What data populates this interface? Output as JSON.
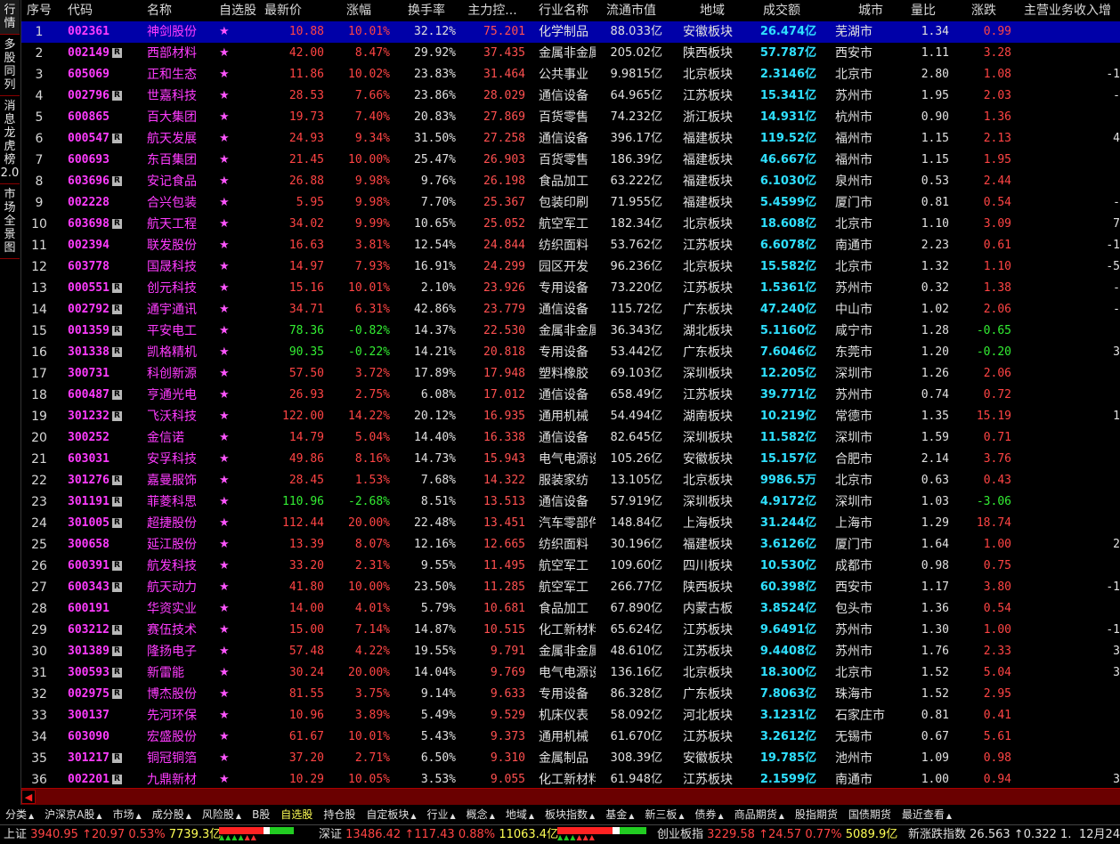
{
  "sidebar": {
    "tabs": [
      "行情",
      "多股同列",
      "消息龙虎榜2.0",
      "市场全景图"
    ]
  },
  "columns": {
    "seq": "序号",
    "code": "代码",
    "name": "名称",
    "fav": "自选股",
    "price": "最新价",
    "pct": "涨幅",
    "turnover": "换手率",
    "main": "主力控...",
    "industry": "行业名称",
    "cap": "流通市值",
    "region": "地域",
    "amount": "成交额",
    "city": "城市",
    "vol_ratio": "量比",
    "change": "涨跌",
    "revenue": "主营业务收入增"
  },
  "rows": [
    {
      "seq": "1",
      "code": "002361",
      "r": false,
      "name": "神剑股份",
      "fav": "★",
      "price": "10.88",
      "pct": "10.01%",
      "turnover": "32.12%",
      "main": "75.201",
      "industry": "化学制品",
      "cap": "88.033亿",
      "region": "安徽板块",
      "amount": "26.474亿",
      "city": "芜湖市",
      "vol_ratio": "1.34",
      "change": "0.99",
      "revenue": "",
      "dir": "up"
    },
    {
      "seq": "2",
      "code": "002149",
      "r": true,
      "name": "西部材料",
      "fav": "★",
      "price": "42.00",
      "pct": "8.47%",
      "turnover": "29.92%",
      "main": "37.435",
      "industry": "金属非金属",
      "cap": "205.02亿",
      "region": "陕西板块",
      "amount": "57.787亿",
      "city": "西安市",
      "vol_ratio": "1.11",
      "change": "3.28",
      "revenue": "",
      "dir": "up"
    },
    {
      "seq": "3",
      "code": "605069",
      "r": false,
      "name": "正和生态",
      "fav": "★",
      "price": "11.86",
      "pct": "10.02%",
      "turnover": "23.83%",
      "main": "31.464",
      "industry": "公共事业",
      "cap": "9.9815亿",
      "region": "北京板块",
      "amount": "2.3146亿",
      "city": "北京市",
      "vol_ratio": "2.80",
      "change": "1.08",
      "revenue": "-1",
      "dir": "up"
    },
    {
      "seq": "4",
      "code": "002796",
      "r": true,
      "name": "世嘉科技",
      "fav": "★",
      "price": "28.53",
      "pct": "7.66%",
      "turnover": "23.86%",
      "main": "28.029",
      "industry": "通信设备",
      "cap": "64.965亿",
      "region": "江苏板块",
      "amount": "15.341亿",
      "city": "苏州市",
      "vol_ratio": "1.95",
      "change": "2.03",
      "revenue": "-",
      "dir": "up"
    },
    {
      "seq": "5",
      "code": "600865",
      "r": false,
      "name": "百大集团",
      "fav": "★",
      "price": "19.73",
      "pct": "7.40%",
      "turnover": "20.83%",
      "main": "27.869",
      "industry": "百货零售",
      "cap": "74.232亿",
      "region": "浙江板块",
      "amount": "14.931亿",
      "city": "杭州市",
      "vol_ratio": "0.90",
      "change": "1.36",
      "revenue": "",
      "dir": "up"
    },
    {
      "seq": "6",
      "code": "000547",
      "r": true,
      "name": "航天发展",
      "fav": "★",
      "price": "24.93",
      "pct": "9.34%",
      "turnover": "31.50%",
      "main": "27.258",
      "industry": "通信设备",
      "cap": "396.17亿",
      "region": "福建板块",
      "amount": "119.52亿",
      "city": "福州市",
      "vol_ratio": "1.15",
      "change": "2.13",
      "revenue": "4",
      "dir": "up"
    },
    {
      "seq": "7",
      "code": "600693",
      "r": false,
      "name": "东百集团",
      "fav": "★",
      "price": "21.45",
      "pct": "10.00%",
      "turnover": "25.47%",
      "main": "26.903",
      "industry": "百货零售",
      "cap": "186.39亿",
      "region": "福建板块",
      "amount": "46.667亿",
      "city": "福州市",
      "vol_ratio": "1.15",
      "change": "1.95",
      "revenue": "",
      "dir": "up"
    },
    {
      "seq": "8",
      "code": "603696",
      "r": true,
      "name": "安记食品",
      "fav": "★",
      "price": "26.88",
      "pct": "9.98%",
      "turnover": "9.76%",
      "main": "26.198",
      "industry": "食品加工",
      "cap": "63.222亿",
      "region": "福建板块",
      "amount": "6.1030亿",
      "city": "泉州市",
      "vol_ratio": "0.53",
      "change": "2.44",
      "revenue": "",
      "dir": "up"
    },
    {
      "seq": "9",
      "code": "002228",
      "r": false,
      "name": "合兴包装",
      "fav": "★",
      "price": "5.95",
      "pct": "9.98%",
      "turnover": "7.70%",
      "main": "25.367",
      "industry": "包装印刷",
      "cap": "71.955亿",
      "region": "福建板块",
      "amount": "5.4599亿",
      "city": "厦门市",
      "vol_ratio": "0.81",
      "change": "0.54",
      "revenue": "-",
      "dir": "up"
    },
    {
      "seq": "10",
      "code": "603698",
      "r": true,
      "name": "航天工程",
      "fav": "★",
      "price": "34.02",
      "pct": "9.99%",
      "turnover": "10.65%",
      "main": "25.052",
      "industry": "航空军工",
      "cap": "182.34亿",
      "region": "北京板块",
      "amount": "18.608亿",
      "city": "北京市",
      "vol_ratio": "1.10",
      "change": "3.09",
      "revenue": "7",
      "dir": "up"
    },
    {
      "seq": "11",
      "code": "002394",
      "r": false,
      "name": "联发股份",
      "fav": "★",
      "price": "16.63",
      "pct": "3.81%",
      "turnover": "12.54%",
      "main": "24.844",
      "industry": "纺织面料",
      "cap": "53.762亿",
      "region": "江苏板块",
      "amount": "6.6078亿",
      "city": "南通市",
      "vol_ratio": "2.23",
      "change": "0.61",
      "revenue": "-1",
      "dir": "up"
    },
    {
      "seq": "12",
      "code": "603778",
      "r": false,
      "name": "国晟科技",
      "fav": "★",
      "price": "14.97",
      "pct": "7.93%",
      "turnover": "16.91%",
      "main": "24.299",
      "industry": "园区开发",
      "cap": "96.236亿",
      "region": "北京板块",
      "amount": "15.582亿",
      "city": "北京市",
      "vol_ratio": "1.32",
      "change": "1.10",
      "revenue": "-5",
      "dir": "up"
    },
    {
      "seq": "13",
      "code": "000551",
      "r": true,
      "name": "创元科技",
      "fav": "★",
      "price": "15.16",
      "pct": "10.01%",
      "turnover": "2.10%",
      "main": "23.926",
      "industry": "专用设备",
      "cap": "73.220亿",
      "region": "江苏板块",
      "amount": "1.5361亿",
      "city": "苏州市",
      "vol_ratio": "0.32",
      "change": "1.38",
      "revenue": "-",
      "dir": "up"
    },
    {
      "seq": "14",
      "code": "002792",
      "r": true,
      "name": "通宇通讯",
      "fav": "★",
      "price": "34.71",
      "pct": "6.31%",
      "turnover": "42.86%",
      "main": "23.779",
      "industry": "通信设备",
      "cap": "115.72亿",
      "region": "广东板块",
      "amount": "47.240亿",
      "city": "中山市",
      "vol_ratio": "1.02",
      "change": "2.06",
      "revenue": "-",
      "dir": "up"
    },
    {
      "seq": "15",
      "code": "001359",
      "r": true,
      "name": "平安电工",
      "fav": "★",
      "price": "78.36",
      "pct": "-0.82%",
      "turnover": "14.37%",
      "main": "22.530",
      "industry": "金属非金属",
      "cap": "36.343亿",
      "region": "湖北板块",
      "amount": "5.1160亿",
      "city": "咸宁市",
      "vol_ratio": "1.28",
      "change": "-0.65",
      "revenue": "",
      "dir": "down"
    },
    {
      "seq": "16",
      "code": "301338",
      "r": true,
      "name": "凯格精机",
      "fav": "★",
      "price": "90.35",
      "pct": "-0.22%",
      "turnover": "14.21%",
      "main": "20.818",
      "industry": "专用设备",
      "cap": "53.442亿",
      "region": "广东板块",
      "amount": "7.6046亿",
      "city": "东莞市",
      "vol_ratio": "1.20",
      "change": "-0.20",
      "revenue": "3",
      "dir": "down"
    },
    {
      "seq": "17",
      "code": "300731",
      "r": false,
      "name": "科创新源",
      "fav": "★",
      "price": "57.50",
      "pct": "3.72%",
      "turnover": "17.89%",
      "main": "17.948",
      "industry": "塑料橡胶",
      "cap": "69.103亿",
      "region": "深圳板块",
      "amount": "12.205亿",
      "city": "深圳市",
      "vol_ratio": "1.26",
      "change": "2.06",
      "revenue": "",
      "dir": "up"
    },
    {
      "seq": "18",
      "code": "600487",
      "r": true,
      "name": "亨通光电",
      "fav": "★",
      "price": "26.93",
      "pct": "2.75%",
      "turnover": "6.08%",
      "main": "17.012",
      "industry": "通信设备",
      "cap": "658.49亿",
      "region": "江苏板块",
      "amount": "39.771亿",
      "city": "苏州市",
      "vol_ratio": "0.74",
      "change": "0.72",
      "revenue": "",
      "dir": "up"
    },
    {
      "seq": "19",
      "code": "301232",
      "r": true,
      "name": "飞沃科技",
      "fav": "★",
      "price": "122.00",
      "pct": "14.22%",
      "turnover": "20.12%",
      "main": "16.935",
      "industry": "通用机械",
      "cap": "54.494亿",
      "region": "湖南板块",
      "amount": "10.219亿",
      "city": "常德市",
      "vol_ratio": "1.35",
      "change": "15.19",
      "revenue": "1",
      "dir": "up"
    },
    {
      "seq": "20",
      "code": "300252",
      "r": false,
      "name": "金信诺",
      "fav": "★",
      "price": "14.79",
      "pct": "5.04%",
      "turnover": "14.40%",
      "main": "16.338",
      "industry": "通信设备",
      "cap": "82.645亿",
      "region": "深圳板块",
      "amount": "11.582亿",
      "city": "深圳市",
      "vol_ratio": "1.59",
      "change": "0.71",
      "revenue": "",
      "dir": "up"
    },
    {
      "seq": "21",
      "code": "603031",
      "r": false,
      "name": "安孚科技",
      "fav": "★",
      "price": "49.86",
      "pct": "8.16%",
      "turnover": "14.73%",
      "main": "15.943",
      "industry": "电气电源设",
      "cap": "105.26亿",
      "region": "安徽板块",
      "amount": "15.157亿",
      "city": "合肥市",
      "vol_ratio": "2.14",
      "change": "3.76",
      "revenue": "",
      "dir": "up"
    },
    {
      "seq": "22",
      "code": "301276",
      "r": true,
      "name": "嘉曼服饰",
      "fav": "★",
      "price": "28.45",
      "pct": "1.53%",
      "turnover": "7.68%",
      "main": "14.322",
      "industry": "服装家纺",
      "cap": "13.105亿",
      "region": "北京板块",
      "amount": "9986.5万",
      "city": "北京市",
      "vol_ratio": "0.63",
      "change": "0.43",
      "revenue": "",
      "dir": "up"
    },
    {
      "seq": "23",
      "code": "301191",
      "r": true,
      "name": "菲菱科思",
      "fav": "★",
      "price": "110.96",
      "pct": "-2.68%",
      "turnover": "8.51%",
      "main": "13.513",
      "industry": "通信设备",
      "cap": "57.919亿",
      "region": "深圳板块",
      "amount": "4.9172亿",
      "city": "深圳市",
      "vol_ratio": "1.03",
      "change": "-3.06",
      "revenue": "",
      "dir": "down"
    },
    {
      "seq": "24",
      "code": "301005",
      "r": true,
      "name": "超捷股份",
      "fav": "★",
      "price": "112.44",
      "pct": "20.00%",
      "turnover": "22.48%",
      "main": "13.451",
      "industry": "汽车零部件",
      "cap": "148.84亿",
      "region": "上海板块",
      "amount": "31.244亿",
      "city": "上海市",
      "vol_ratio": "1.29",
      "change": "18.74",
      "revenue": "",
      "dir": "up"
    },
    {
      "seq": "25",
      "code": "300658",
      "r": false,
      "name": "延江股份",
      "fav": "★",
      "price": "13.39",
      "pct": "8.07%",
      "turnover": "12.16%",
      "main": "12.665",
      "industry": "纺织面料",
      "cap": "30.196亿",
      "region": "福建板块",
      "amount": "3.6126亿",
      "city": "厦门市",
      "vol_ratio": "1.64",
      "change": "1.00",
      "revenue": "2",
      "dir": "up"
    },
    {
      "seq": "26",
      "code": "600391",
      "r": true,
      "name": "航发科技",
      "fav": "★",
      "price": "33.20",
      "pct": "2.31%",
      "turnover": "9.55%",
      "main": "11.495",
      "industry": "航空军工",
      "cap": "109.60亿",
      "region": "四川板块",
      "amount": "10.530亿",
      "city": "成都市",
      "vol_ratio": "0.98",
      "change": "0.75",
      "revenue": "",
      "dir": "up"
    },
    {
      "seq": "27",
      "code": "600343",
      "r": true,
      "name": "航天动力",
      "fav": "★",
      "price": "41.80",
      "pct": "10.00%",
      "turnover": "23.50%",
      "main": "11.285",
      "industry": "航空军工",
      "cap": "266.77亿",
      "region": "陕西板块",
      "amount": "60.398亿",
      "city": "西安市",
      "vol_ratio": "1.17",
      "change": "3.80",
      "revenue": "-1",
      "dir": "up"
    },
    {
      "seq": "28",
      "code": "600191",
      "r": false,
      "name": "华资实业",
      "fav": "★",
      "price": "14.00",
      "pct": "4.01%",
      "turnover": "5.79%",
      "main": "10.681",
      "industry": "食品加工",
      "cap": "67.890亿",
      "region": "内蒙古板",
      "amount": "3.8524亿",
      "city": "包头市",
      "vol_ratio": "1.36",
      "change": "0.54",
      "revenue": "",
      "dir": "up"
    },
    {
      "seq": "29",
      "code": "603212",
      "r": true,
      "name": "赛伍技术",
      "fav": "★",
      "price": "15.00",
      "pct": "7.14%",
      "turnover": "14.87%",
      "main": "10.515",
      "industry": "化工新材料",
      "cap": "65.624亿",
      "region": "江苏板块",
      "amount": "9.6491亿",
      "city": "苏州市",
      "vol_ratio": "1.30",
      "change": "1.00",
      "revenue": "-1",
      "dir": "up"
    },
    {
      "seq": "30",
      "code": "301389",
      "r": true,
      "name": "隆扬电子",
      "fav": "★",
      "price": "57.48",
      "pct": "4.22%",
      "turnover": "19.55%",
      "main": "9.791",
      "industry": "金属非金属",
      "cap": "48.610亿",
      "region": "江苏板块",
      "amount": "9.4408亿",
      "city": "苏州市",
      "vol_ratio": "1.76",
      "change": "2.33",
      "revenue": "3",
      "dir": "up"
    },
    {
      "seq": "31",
      "code": "300593",
      "r": true,
      "name": "新雷能",
      "fav": "★",
      "price": "30.24",
      "pct": "20.00%",
      "turnover": "14.04%",
      "main": "9.769",
      "industry": "电气电源设",
      "cap": "136.16亿",
      "region": "北京板块",
      "amount": "18.300亿",
      "city": "北京市",
      "vol_ratio": "1.52",
      "change": "5.04",
      "revenue": "3",
      "dir": "up"
    },
    {
      "seq": "32",
      "code": "002975",
      "r": true,
      "name": "博杰股份",
      "fav": "★",
      "price": "81.55",
      "pct": "3.75%",
      "turnover": "9.14%",
      "main": "9.633",
      "industry": "专用设备",
      "cap": "86.328亿",
      "region": "广东板块",
      "amount": "7.8063亿",
      "city": "珠海市",
      "vol_ratio": "1.52",
      "change": "2.95",
      "revenue": "",
      "dir": "up"
    },
    {
      "seq": "33",
      "code": "300137",
      "r": false,
      "name": "先河环保",
      "fav": "★",
      "price": "10.96",
      "pct": "3.89%",
      "turnover": "5.49%",
      "main": "9.529",
      "industry": "机床仪表",
      "cap": "58.092亿",
      "region": "河北板块",
      "amount": "3.1231亿",
      "city": "石家庄市",
      "vol_ratio": "0.81",
      "change": "0.41",
      "revenue": "",
      "dir": "up"
    },
    {
      "seq": "34",
      "code": "603090",
      "r": false,
      "name": "宏盛股份",
      "fav": "★",
      "price": "61.67",
      "pct": "10.01%",
      "turnover": "5.43%",
      "main": "9.373",
      "industry": "通用机械",
      "cap": "61.670亿",
      "region": "江苏板块",
      "amount": "3.2612亿",
      "city": "无锡市",
      "vol_ratio": "0.67",
      "change": "5.61",
      "revenue": "",
      "dir": "up"
    },
    {
      "seq": "35",
      "code": "301217",
      "r": true,
      "name": "铜冠铜箔",
      "fav": "★",
      "price": "37.20",
      "pct": "2.71%",
      "turnover": "6.50%",
      "main": "9.310",
      "industry": "金属制品",
      "cap": "308.39亿",
      "region": "安徽板块",
      "amount": "19.785亿",
      "city": "池州市",
      "vol_ratio": "1.09",
      "change": "0.98",
      "revenue": "",
      "dir": "up"
    },
    {
      "seq": "36",
      "code": "002201",
      "r": true,
      "name": "九鼎新材",
      "fav": "★",
      "price": "10.29",
      "pct": "10.05%",
      "turnover": "3.53%",
      "main": "9.055",
      "industry": "化工新材料",
      "cap": "61.948亿",
      "region": "江苏板块",
      "amount": "2.1599亿",
      "city": "南通市",
      "vol_ratio": "1.00",
      "change": "0.94",
      "revenue": "3",
      "dir": "up"
    }
  ],
  "badge_label": "R",
  "bottom_tabs": [
    {
      "label": "分类",
      "arrow": "▲"
    },
    {
      "label": "沪深京A股",
      "arrow": "▲"
    },
    {
      "label": "市场",
      "arrow": "▲"
    },
    {
      "label": "成分股",
      "arrow": "▲"
    },
    {
      "label": "风险股",
      "arrow": "▲"
    },
    {
      "label": "B股",
      "arrow": ""
    },
    {
      "label": "自选股",
      "arrow": ""
    },
    {
      "label": "持仓股",
      "arrow": ""
    },
    {
      "label": "自定板块",
      "arrow": "▲"
    },
    {
      "label": "行业",
      "arrow": "▲"
    },
    {
      "label": "概念",
      "arrow": "▲"
    },
    {
      "label": "地域",
      "arrow": "▲"
    },
    {
      "label": "板块指数",
      "arrow": "▲"
    },
    {
      "label": "基金",
      "arrow": "▲"
    },
    {
      "label": "新三板",
      "arrow": "▲"
    },
    {
      "label": "债券",
      "arrow": "▲"
    },
    {
      "label": "商品期货",
      "arrow": "▲"
    },
    {
      "label": "股指期货",
      "arrow": ""
    },
    {
      "label": "国债期货",
      "arrow": ""
    },
    {
      "label": "最近查看",
      "arrow": "▲"
    }
  ],
  "status_bar": {
    "sh": {
      "label": "上证",
      "value": "3940.95",
      "chg": "↑20.97",
      "pct": "0.53%",
      "amount": "7739.3亿"
    },
    "sz": {
      "label": "深证",
      "value": "13486.42",
      "chg": "↑117.43",
      "pct": "0.88%",
      "amount": "11063.4亿"
    },
    "cy": {
      "label": "创业板指",
      "value": "3229.58",
      "chg": "↑24.57",
      "pct": "0.77%",
      "amount": "5089.9亿"
    },
    "nx": {
      "label": "新涨跌指数",
      "value": "26.563",
      "chg": "↑0.322",
      "pct": "1."
    },
    "date": "12月24"
  },
  "colors": {
    "up": "#ff4444",
    "down": "#33ee33",
    "selected": "#0000a8",
    "code": "#ff3cff",
    "amount": "#2fe0ff"
  }
}
